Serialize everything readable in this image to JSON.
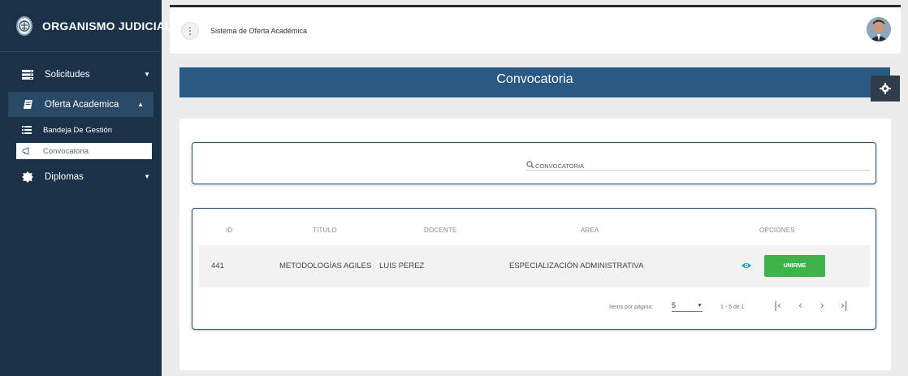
{
  "sidebar": {
    "brand": "ORGANISMO JUDICIAL",
    "items": [
      {
        "label": "Solicitudes",
        "icon": "server-icon"
      },
      {
        "label": "Oferta Academica",
        "icon": "book-icon"
      },
      {
        "label": "Diplomas",
        "icon": "gear-badge-icon"
      }
    ],
    "subitems": [
      {
        "label": "Bandeja De Gestión",
        "icon": "list-icon"
      },
      {
        "label": "Convocatoria",
        "icon": "megaphone-icon"
      }
    ]
  },
  "topbar": {
    "app_name": "Sistema de Oferta Académica"
  },
  "page": {
    "title": "Convocatoria"
  },
  "search": {
    "placeholder": "CONVOCATORIA"
  },
  "table": {
    "headers": [
      "ID",
      "TITULO",
      "DOCENTE",
      "AREA",
      "OPCIONES"
    ],
    "rows": [
      {
        "id": "441",
        "titulo": "METODOLOGÍAS AGILES",
        "docente": "LUIS PEREZ",
        "area": "ESPECIALIZACIÓN ADMINISTRATIVA",
        "action": "UNIRME"
      }
    ]
  },
  "paginator": {
    "items_label": "Items por página:",
    "page_size": "5",
    "range": "1 - 5 de 1"
  },
  "colors": {
    "sidebar": "#1a3148",
    "header_band": "#2a5a83",
    "accent_green": "#3fb34a",
    "eye": "#1aa6b7"
  }
}
